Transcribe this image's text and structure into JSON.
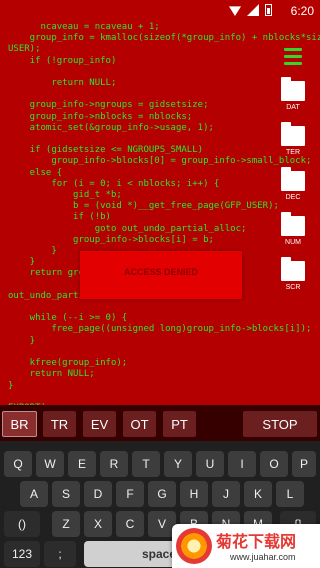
{
  "status_bar": {
    "time": "6:20"
  },
  "code_lines": [
    "      ncaveau = ncaveau + 1;",
    "    group_info = kmalloc(sizeof(*group_info) + nblocks*sizeof(gid_t *), GFP_",
    "USER);",
    "    if (!group_info)",
    "",
    "        return NULL;",
    "",
    "    group_info->ngroups = gidsetsize;",
    "    group_info->nblocks = nblocks;",
    "    atomic_set(&group_info->usage, 1);",
    "",
    "    if (gidsetsize <= NGROUPS_SMALL)",
    "        group_info->blocks[0] = group_info->small_block;",
    "    else {",
    "        for (i = 0; i < nblocks; i++) {",
    "            gid_t *b;",
    "            b = (void *)__get_free_page(GFP_USER);",
    "            if (!b)",
    "                goto out_undo_partial_alloc;",
    "            group_info->blocks[i] = b;",
    "        }",
    "    }",
    "    return group_in",
    "",
    "out_undo_partial",
    "",
    "    while (--i >= 0) {",
    "        free_page((unsigned long)group_info->blocks[i]);",
    "    }",
    "",
    "    kfree(group_info);",
    "    return NULL;",
    "}",
    "",
    "EXPORT|"
  ],
  "sidebar": {
    "folders": [
      {
        "label": "DAT"
      },
      {
        "label": "TER"
      },
      {
        "label": "DEC"
      },
      {
        "label": "NUM"
      },
      {
        "label": "SCR"
      }
    ]
  },
  "overlay": {
    "text": "ACCESS DENIED"
  },
  "commands": [
    "BR",
    "TR",
    "EV",
    "OT",
    "PT"
  ],
  "stop_label": "STOP",
  "keyboard": {
    "row1": [
      "Q",
      "W",
      "E",
      "R",
      "T",
      "Y",
      "U",
      "I",
      "O",
      "P"
    ],
    "row2": [
      "A",
      "S",
      "D",
      "F",
      "G",
      "H",
      "J",
      "K",
      "L"
    ],
    "row3": [
      "()",
      "Z",
      "X",
      "C",
      "V",
      "B",
      "N",
      "M",
      "{}"
    ],
    "row4": [
      "123",
      ";",
      "space"
    ]
  },
  "watermark": {
    "title": "菊花下载网",
    "url": "www.juahar.com"
  },
  "colors": {
    "code_bg": "#b40000",
    "code_text": "#31e331",
    "denied_box": "#e30000"
  }
}
